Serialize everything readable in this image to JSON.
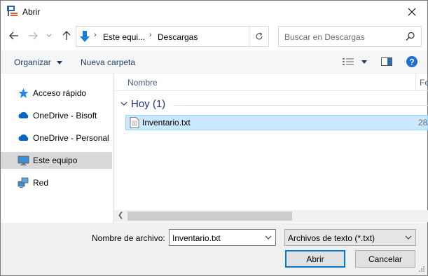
{
  "window": {
    "title": "Abrir"
  },
  "address": {
    "crumbs": [
      "Este equi...",
      "Descargas"
    ]
  },
  "search": {
    "placeholder": "Buscar en Descargas"
  },
  "toolbar": {
    "organize": "Organizar",
    "new_folder": "Nueva carpeta"
  },
  "sidebar": {
    "items": [
      {
        "label": "Acceso rápido",
        "icon": "star-icon"
      },
      {
        "label": "OneDrive - Bisoft",
        "icon": "cloud-icon"
      },
      {
        "label": "OneDrive - Personal",
        "icon": "cloud-icon"
      },
      {
        "label": "Este equipo",
        "icon": "computer-icon"
      },
      {
        "label": "Red",
        "icon": "network-icon"
      }
    ]
  },
  "columns": {
    "name": "Nombre",
    "date": "Fec"
  },
  "group": {
    "label": "Hoy (1)"
  },
  "files": [
    {
      "name": "Inventario.txt",
      "date": "28/"
    }
  ],
  "bottom": {
    "filename_label": "Nombre de archivo:",
    "filename_value": "Inventario.txt",
    "filter": "Archivos de texto (*.txt)",
    "open": "Abrir",
    "cancel": "Cancelar"
  },
  "colors": {
    "accent": "#0078d7",
    "selection": "#cce8ff",
    "group_text": "#1e3287"
  }
}
